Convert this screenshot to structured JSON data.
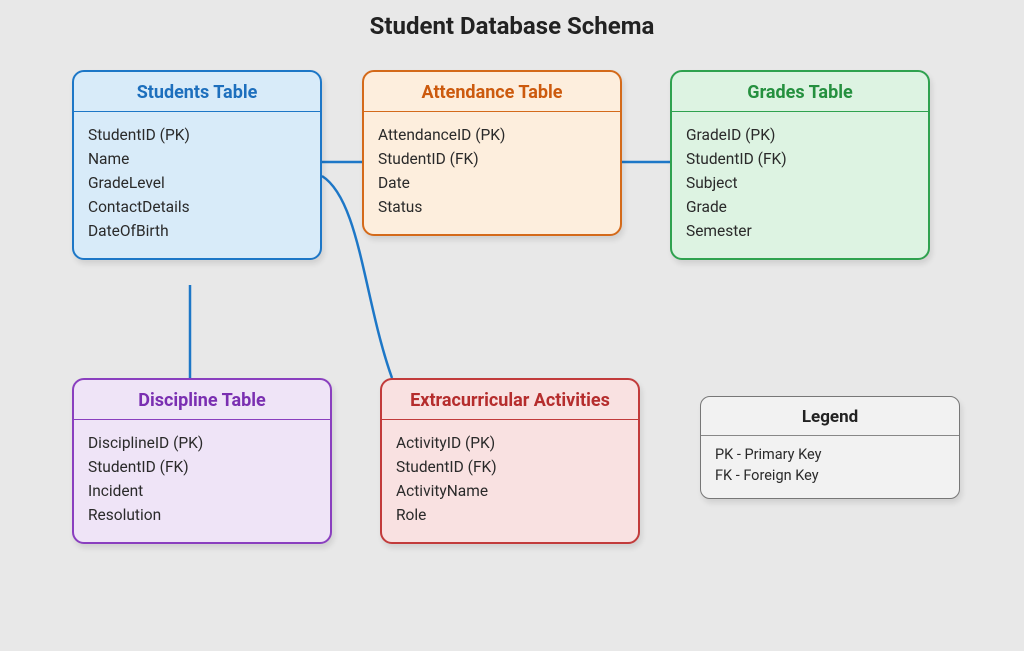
{
  "title": "Student Database Schema",
  "entities": {
    "students": {
      "name": "Students Table",
      "fields": [
        "StudentID (PK)",
        "Name",
        "GradeLevel",
        "ContactDetails",
        "DateOfBirth"
      ]
    },
    "attendance": {
      "name": "Attendance Table",
      "fields": [
        "AttendanceID (PK)",
        "StudentID (FK)",
        "Date",
        "Status"
      ]
    },
    "grades": {
      "name": "Grades Table",
      "fields": [
        "GradeID (PK)",
        "StudentID (FK)",
        "Subject",
        "Grade",
        "Semester"
      ]
    },
    "discipline": {
      "name": "Discipline Table",
      "fields": [
        "DisciplineID (PK)",
        "StudentID (FK)",
        "Incident",
        "Resolution"
      ]
    },
    "extracurricular": {
      "name": "Extracurricular Activities",
      "fields": [
        "ActivityID (PK)",
        "StudentID (FK)",
        "ActivityName",
        "Role"
      ]
    }
  },
  "legend": {
    "title": "Legend",
    "items": [
      "PK - Primary Key",
      "FK - Foreign Key"
    ]
  },
  "relationships": [
    {
      "from": "students",
      "to": "attendance"
    },
    {
      "from": "students",
      "to": "grades"
    },
    {
      "from": "students",
      "to": "discipline"
    },
    {
      "from": "students",
      "to": "extracurricular"
    }
  ]
}
